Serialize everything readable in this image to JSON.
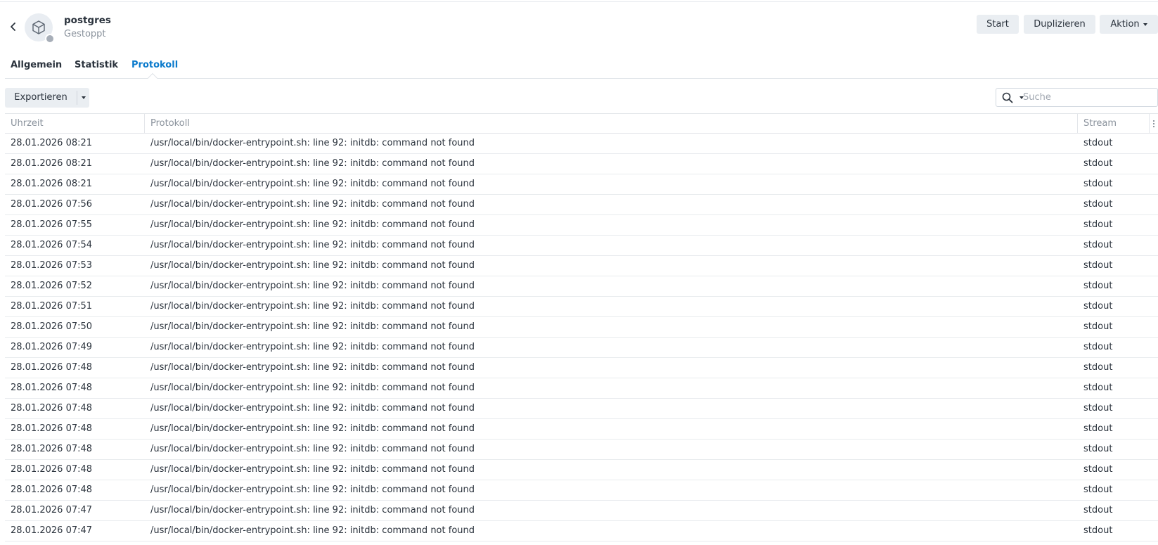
{
  "header": {
    "container_name": "postgres",
    "status": "Gestoppt",
    "buttons": {
      "start": "Start",
      "duplicate": "Duplizieren",
      "action": "Aktion"
    }
  },
  "tabs": [
    {
      "label": "Allgemein",
      "active": false
    },
    {
      "label": "Statistik",
      "active": false
    },
    {
      "label": "Protokoll",
      "active": true
    }
  ],
  "toolbar": {
    "export_label": "Exportieren",
    "search_placeholder": "Suche"
  },
  "table": {
    "columns": {
      "time": "Uhrzeit",
      "log": "Protokoll",
      "stream": "Stream"
    },
    "rows": [
      {
        "time": "28.01.2026 08:21",
        "log": "/usr/local/bin/docker-entrypoint.sh: line 92: initdb: command not found",
        "stream": "stdout"
      },
      {
        "time": "28.01.2026 08:21",
        "log": "/usr/local/bin/docker-entrypoint.sh: line 92: initdb: command not found",
        "stream": "stdout"
      },
      {
        "time": "28.01.2026 08:21",
        "log": "/usr/local/bin/docker-entrypoint.sh: line 92: initdb: command not found",
        "stream": "stdout"
      },
      {
        "time": "28.01.2026 07:56",
        "log": "/usr/local/bin/docker-entrypoint.sh: line 92: initdb: command not found",
        "stream": "stdout"
      },
      {
        "time": "28.01.2026 07:55",
        "log": "/usr/local/bin/docker-entrypoint.sh: line 92: initdb: command not found",
        "stream": "stdout"
      },
      {
        "time": "28.01.2026 07:54",
        "log": "/usr/local/bin/docker-entrypoint.sh: line 92: initdb: command not found",
        "stream": "stdout"
      },
      {
        "time": "28.01.2026 07:53",
        "log": "/usr/local/bin/docker-entrypoint.sh: line 92: initdb: command not found",
        "stream": "stdout"
      },
      {
        "time": "28.01.2026 07:52",
        "log": "/usr/local/bin/docker-entrypoint.sh: line 92: initdb: command not found",
        "stream": "stdout"
      },
      {
        "time": "28.01.2026 07:51",
        "log": "/usr/local/bin/docker-entrypoint.sh: line 92: initdb: command not found",
        "stream": "stdout"
      },
      {
        "time": "28.01.2026 07:50",
        "log": "/usr/local/bin/docker-entrypoint.sh: line 92: initdb: command not found",
        "stream": "stdout"
      },
      {
        "time": "28.01.2026 07:49",
        "log": "/usr/local/bin/docker-entrypoint.sh: line 92: initdb: command not found",
        "stream": "stdout"
      },
      {
        "time": "28.01.2026 07:48",
        "log": "/usr/local/bin/docker-entrypoint.sh: line 92: initdb: command not found",
        "stream": "stdout"
      },
      {
        "time": "28.01.2026 07:48",
        "log": "/usr/local/bin/docker-entrypoint.sh: line 92: initdb: command not found",
        "stream": "stdout"
      },
      {
        "time": "28.01.2026 07:48",
        "log": "/usr/local/bin/docker-entrypoint.sh: line 92: initdb: command not found",
        "stream": "stdout"
      },
      {
        "time": "28.01.2026 07:48",
        "log": "/usr/local/bin/docker-entrypoint.sh: line 92: initdb: command not found",
        "stream": "stdout"
      },
      {
        "time": "28.01.2026 07:48",
        "log": "/usr/local/bin/docker-entrypoint.sh: line 92: initdb: command not found",
        "stream": "stdout"
      },
      {
        "time": "28.01.2026 07:48",
        "log": "/usr/local/bin/docker-entrypoint.sh: line 92: initdb: command not found",
        "stream": "stdout"
      },
      {
        "time": "28.01.2026 07:48",
        "log": "/usr/local/bin/docker-entrypoint.sh: line 92: initdb: command not found",
        "stream": "stdout"
      },
      {
        "time": "28.01.2026 07:47",
        "log": "/usr/local/bin/docker-entrypoint.sh: line 92: initdb: command not found",
        "stream": "stdout"
      },
      {
        "time": "28.01.2026 07:47",
        "log": "/usr/local/bin/docker-entrypoint.sh: line 92: initdb: command not found",
        "stream": "stdout"
      }
    ]
  },
  "colors": {
    "accent": "#0a7acc",
    "button_bg": "#eaeef2",
    "status_stopped": "#a7aeb8",
    "muted_text": "#8a929c"
  },
  "icons": {
    "back": "chevron-left-icon",
    "container": "cube-icon",
    "search": "search-icon",
    "column_menu": "vertical-dots-icon"
  }
}
